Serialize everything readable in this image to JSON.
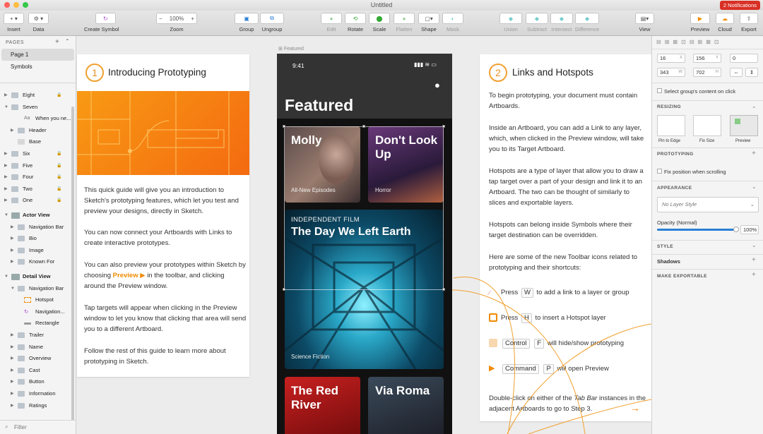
{
  "window": {
    "title": "Untitled",
    "notifications": "2 Notifications",
    "traffic_colors": [
      "#fc605c",
      "#fdbc40",
      "#34c84a"
    ]
  },
  "toolbar": {
    "insert": "Insert",
    "data": "Data",
    "create_symbol": "Create Symbol",
    "zoom": "Zoom",
    "zoom_minus": "−",
    "zoom_level": "100%",
    "zoom_plus": "+",
    "group": "Group",
    "ungroup": "Ungroup",
    "edit": "Edit",
    "rotate": "Rotate",
    "scale": "Scale",
    "flatten": "Flatten",
    "shape": "Shape",
    "mask": "Mask",
    "union": "Union",
    "subtract": "Subtract",
    "intersect": "Intersect",
    "difference": "Difference",
    "view": "View",
    "preview": "Preview",
    "cloud": "Cloud",
    "export": "Export"
  },
  "sidebar": {
    "pages_header": "PAGES",
    "pages": [
      "Page 1",
      "Symbols"
    ],
    "layers": [
      {
        "name": "Eight",
        "locked": true
      },
      {
        "name": "Seven",
        "open": true
      },
      {
        "name": "When you ne..."
      },
      {
        "name": "Header"
      },
      {
        "name": "Base"
      },
      {
        "name": "Six",
        "locked": true
      },
      {
        "name": "Five",
        "locked": true
      },
      {
        "name": "Four",
        "locked": true
      },
      {
        "name": "Two",
        "locked": true
      },
      {
        "name": "One",
        "locked": true
      },
      {
        "name": "Actor View",
        "bold": true
      },
      {
        "name": "Navigation Bar"
      },
      {
        "name": "Bio"
      },
      {
        "name": "Image"
      },
      {
        "name": "Known For"
      },
      {
        "name": "Detail View",
        "bold": true
      },
      {
        "name": "Navigation Bar"
      },
      {
        "name": "Hotspot"
      },
      {
        "name": "Navigation..."
      },
      {
        "name": "Rectangle"
      },
      {
        "name": "Trailer"
      },
      {
        "name": "Name"
      },
      {
        "name": "Overview"
      },
      {
        "name": "Cast"
      },
      {
        "name": "Button"
      },
      {
        "name": "Information"
      },
      {
        "name": "Ratings"
      }
    ],
    "filter": "Filter"
  },
  "canvas": {
    "artboard_label": "Featured",
    "card1": {
      "num": "1",
      "title": "Introducing Prototyping",
      "p1": "This quick guide will give you an introduction to Sketch's prototyping features, which let you test and preview your designs, directly in Sketch.",
      "p2": "You can now connect your Artboards with Links to create interactive prototypes.",
      "p3a": "You can also preview your prototypes within Sketch by choosing",
      "p3b": "Preview",
      "p3c": "in the toolbar, and clicking around the Preview window.",
      "p4": "Tap targets will appear when clicking in the Preview window to let you know that clicking that area will send you to a different Artboard.",
      "p5": "Follow the rest of this guide to learn more about prototyping in Sketch."
    },
    "card2": {
      "num": "2",
      "title": "Links and Hotspots",
      "p1": "To begin prototyping, your document must contain Artboards.",
      "p2": "Inside an Artboard, you can add a Link to any layer, which, when clicked in the Preview window, will take you to its Target Artboard.",
      "p3": "Hotspots are a type of layer that allow you to draw a tap target over a part of your design and link it to an Artboard. The two can be thought of similarly to slices and exportable layers.",
      "p4": "Hotspots can belong inside Symbols where their target destination can be overridden.",
      "p5": "Here are some of the new Toolbar icons related to prototyping and their shortcuts:",
      "s1_pre": "Press",
      "s1_key": "W",
      "s1_txt": "to add a link to a layer or group",
      "s2_pre": "Press",
      "s2_key": "H",
      "s2_txt": "to insert a Hotspot layer",
      "s3_key1": "Control",
      "s3_key2": "F",
      "s3_txt": "will hide/show prototyping",
      "s4_key1": "Command",
      "s4_key2": "P",
      "s4_txt": "will open Preview",
      "p6a": "Double-click on either of the",
      "p6b": "Tab Bar",
      "p6c": "instances in the adjacent Artboards to go to Step 3."
    },
    "phone": {
      "time": "9:41",
      "title": "Featured",
      "tiles": [
        {
          "t1": "Molly",
          "t2": "All-New Episodes"
        },
        {
          "t1": "Don't Look Up",
          "t2": "Horror"
        },
        {
          "t0": "INDEPENDENT FILM",
          "t1": "The Day We Left Earth",
          "t2": "Science Fiction"
        },
        {
          "t1": "The Red River"
        },
        {
          "t1": "Via Roma"
        }
      ]
    }
  },
  "inspector": {
    "x": "16",
    "x_unit": "X",
    "y": "156",
    "y_unit": "Y",
    "rot": "0",
    "w": "343",
    "w_unit": "W",
    "h": "702",
    "h_unit": "H",
    "select_content": "Select group's content on click",
    "resizing": "RESIZING",
    "pin": "Pin to Edge",
    "fix": "Fix Size",
    "preview": "Preview",
    "prototyping": "PROTOTYPING",
    "fix_scroll": "Fix position when scrolling",
    "appearance": "APPEARANCE",
    "layer_style": "No Layer Style",
    "opacity_label": "Opacity (Normal)",
    "opacity": "100%",
    "opacity_value": 1.0,
    "style": "STYLE",
    "shadows": "Shadows",
    "make_exportable": "MAKE EXPORTABLE"
  }
}
